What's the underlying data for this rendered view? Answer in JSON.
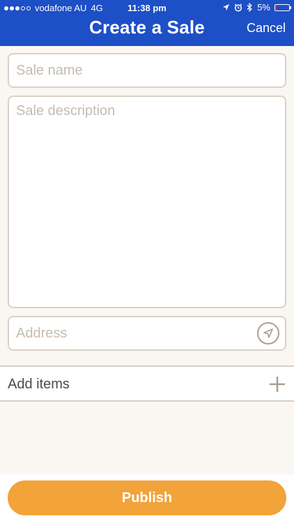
{
  "status_bar": {
    "carrier": "vodafone AU",
    "network": "4G",
    "time": "11:38 pm",
    "battery": "5%",
    "battery_level": 0.05,
    "signal_bars_filled": 3,
    "signal_bars_total": 5,
    "icons": [
      "location-arrow-icon",
      "alarm-clock-icon",
      "bluetooth-icon",
      "battery-icon"
    ]
  },
  "header": {
    "title": "Create a Sale",
    "cancel_label": "Cancel"
  },
  "form": {
    "name_placeholder": "Sale name",
    "description_placeholder": "Sale description",
    "address_placeholder": "Address",
    "locate_icon": "navigation-arrow-icon"
  },
  "add_items": {
    "label": "Add items",
    "icon": "plus-icon"
  },
  "footer": {
    "publish_label": "Publish"
  },
  "colors": {
    "header_blue": "#1d4fc6",
    "publish_orange": "#f2a33a",
    "background": "#faf6f2",
    "border": "#d9d1c7",
    "placeholder": "#c4bcb2"
  }
}
